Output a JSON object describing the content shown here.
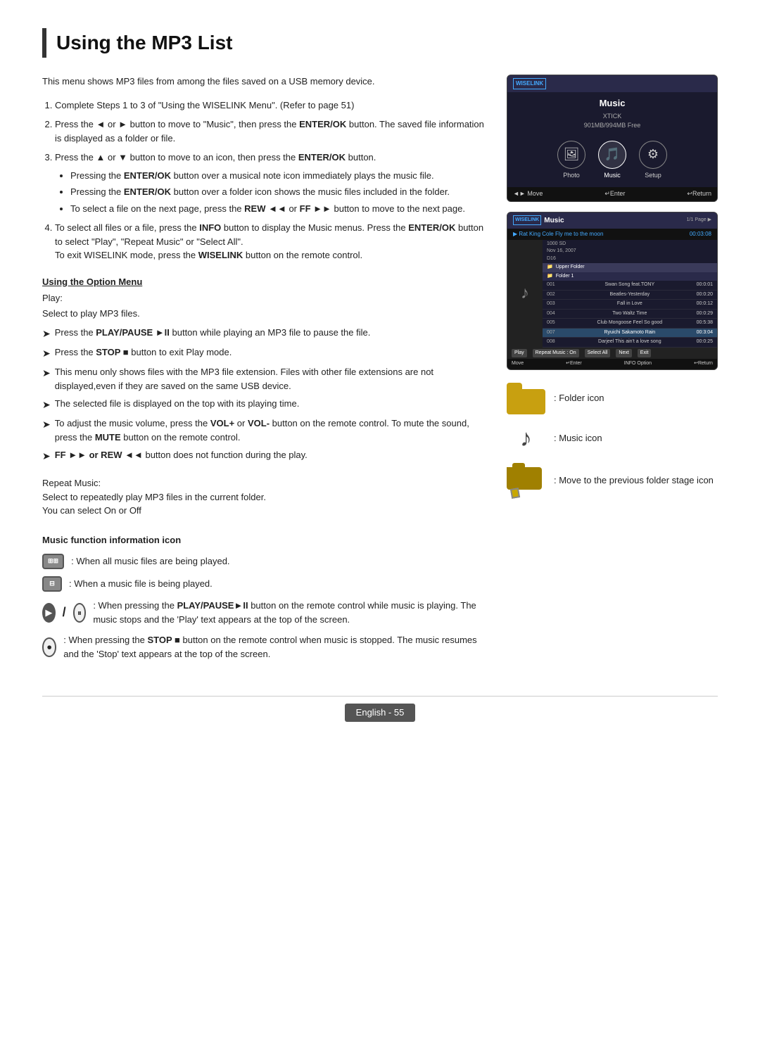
{
  "page": {
    "title": "Using the MP3 List",
    "footer": "English - 55"
  },
  "intro": "This menu shows MP3 files from among the files saved on a USB memory device.",
  "steps": [
    {
      "num": 1,
      "text": "Complete Steps 1 to 3 of \"Using the WISELINK Menu\". (Refer to page 51)"
    },
    {
      "num": 2,
      "text_before": "Press the ◄ or ► button to move to \"Music\", then press the ",
      "bold1": "ENTER/OK",
      "text_mid": " button. The saved file information is displayed as a folder or file."
    },
    {
      "num": 3,
      "text_before": "Press the ▲ or ▼ button to move to an icon, then press the ",
      "bold1": "ENTER/OK",
      "text_mid": " button.",
      "subitems": [
        {
          "text_before": "Pressing the ",
          "bold": "ENTER/OK",
          "text_after": " button over a musical note icon immediately plays the music file."
        },
        {
          "text_before": "Pressing the ",
          "bold": "ENTER/OK",
          "text_after": " button over a folder icon shows the music files included in the folder."
        },
        {
          "text_before": "To select a file on the next page, press the ",
          "bold": "REW ◄◄",
          "text_mid": " or ",
          "bold2": "FF",
          "text_after": " ►► button to move to the next page."
        }
      ]
    },
    {
      "num": 4,
      "text_before": "To select all files or a file, press the ",
      "bold1": "INFO",
      "text_mid1": " button to display the Music menus. Press the ",
      "bold2": "ENTER/OK",
      "text_mid2": " button to select \"Play\", \"Repeat Music\" or \"Select All\".",
      "extra_before": "To exit WISELINK mode, press the ",
      "bold3": "WISELINK",
      "extra_after": " button on the remote control."
    }
  ],
  "option_menu": {
    "heading": "Using the Option Menu",
    "play_label": "Play:",
    "play_desc": "Select to play MP3 files.",
    "arrow_items": [
      {
        "text_before": "Press the ",
        "bold": "PLAY/PAUSE ►II",
        "text_after": " button while playing an MP3 file to pause the file."
      },
      {
        "text_before": "Press the ",
        "bold": "STOP ■",
        "text_after": " button to exit Play mode."
      },
      {
        "text": "This menu only shows files with the MP3 file extension. Files with other file extensions are not displayed,even if they are saved on the same USB device."
      },
      {
        "text": "The selected file is displayed on the top with its playing time."
      },
      {
        "text_before": "To adjust the music volume, press the ",
        "bold": "VOL+",
        "text_mid": " or ",
        "bold2": "VOL-",
        "text_after": " button on the remote control. To mute the sound, press the ",
        "bold3": "MUTE",
        "text_end": " button on the remote control."
      },
      {
        "text_before": "",
        "bold": "FF ►► or REW ◄◄",
        "text_after": " button does not function during the play."
      }
    ]
  },
  "repeat_section": {
    "label": "Repeat Music:",
    "desc1": "Select to repeatedly play MP3 files in the current folder.",
    "desc2": "You can select On or Off"
  },
  "music_func": {
    "heading": "Music function information icon",
    "items": [
      {
        "icon_type": "box_double",
        "label": ": When all music files are being played."
      },
      {
        "icon_type": "box_single",
        "label": ": When a music file is being played."
      },
      {
        "icon_type": "play_pause",
        "label_before": ": When pressing the ",
        "bold": "PLAY/PAUSE►II",
        "label_after": " button on the remote control while music is playing. The music stops and the 'Play' text appears at the top of the screen."
      },
      {
        "icon_type": "stop_circle",
        "label_before": ": When pressing the ",
        "bold": "STOP ■",
        "label_after": " button on the remote control when music is stopped. The music resumes and the 'Stop' text appears at the top of the screen."
      }
    ]
  },
  "ui_screen1": {
    "logo": "WISELINK",
    "title": "Music",
    "sub": "XTICK\n901MB/994MB Free",
    "icons": [
      {
        "label": "Photo",
        "symbol": "🖼"
      },
      {
        "label": "Music",
        "symbol": "🎵",
        "selected": true
      },
      {
        "label": "Setup",
        "symbol": "⚙"
      }
    ],
    "nav": "◄► Move   ↵Enter   ↩Return"
  },
  "ui_screen2": {
    "logo": "WISELINK",
    "title": "Music",
    "now_playing": "Rat King Cole Fly me to the moon   00:03:08",
    "folder_items": [
      {
        "type": "folder",
        "name": "Upper Folder"
      },
      {
        "type": "folder",
        "name": "Folder 1"
      },
      {
        "type": "file",
        "num": "001",
        "name": "Swan Song feat.TONY",
        "time": "00:0:01"
      },
      {
        "type": "file",
        "num": "002",
        "name": "Beatles-Yesterday",
        "time": "00:0:20"
      },
      {
        "type": "file",
        "num": "003",
        "name": "Fall in Love",
        "time": "00:0:12"
      },
      {
        "type": "file",
        "num": "004",
        "name": "Two Waltz Time",
        "time": "00:0:29"
      },
      {
        "type": "file",
        "num": "005",
        "name": "Club Mongoose Feel So good",
        "time": "00:5:38"
      },
      {
        "type": "file",
        "num": "007",
        "name": "Ryuichi Sakamoto Rain",
        "time": "00:3:04",
        "highlighted": true
      },
      {
        "type": "file",
        "num": "008",
        "name": "Darjeel This ain't a love song",
        "time": "00:0:25"
      }
    ],
    "menu_items": [
      "Play",
      "Repeat Music : On",
      "Select All",
      "Next",
      "Exit"
    ],
    "nav": "Move ↵Enter INFO Option ↩Return"
  },
  "icons_legend": [
    {
      "type": "folder",
      "label": ": Folder icon"
    },
    {
      "type": "music",
      "label": ": Music icon"
    },
    {
      "type": "prev_folder",
      "label": ": Move to the previous folder stage icon"
    }
  ]
}
